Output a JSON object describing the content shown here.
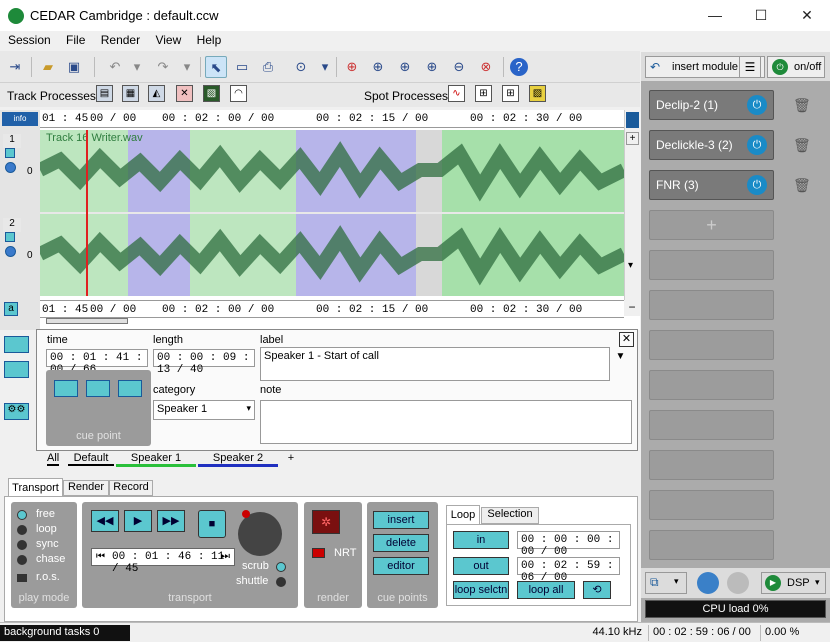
{
  "window": {
    "title": "CEDAR Cambridge : default.ccw",
    "minimize": "—",
    "maximize": "☐",
    "close": "✕"
  },
  "menu": [
    "Session",
    "File",
    "Render",
    "View",
    "Help"
  ],
  "processes": {
    "track_label": "Track Processes",
    "spot_label": "Spot Processes"
  },
  "waveform": {
    "ruler_marks": [
      "01 : 45",
      "00 / 00",
      "00 : 02 : 00 / 00",
      "00 : 02 : 15 / 00",
      "00 : 02 : 30 / 00"
    ],
    "track_name": "Track 16 Writer.wav",
    "channel_1": "1",
    "channel_2": "2",
    "zero_1": "0",
    "zero_2": "0",
    "info_label": "info",
    "a_label": "a",
    "zoom_plus": "+",
    "zoom_minus": "−"
  },
  "right_panel": {
    "insert_module": "insert module",
    "onoff": "on/off",
    "modules": [
      "Declip-2 (1)",
      "Declickle-3 (2)",
      "FNR (3)"
    ],
    "add": "+",
    "dsp": "DSP",
    "cpu_load": "CPU load 0%"
  },
  "cue": {
    "time_label": "time",
    "time_value": "00 : 01 : 41 : 00 / 66",
    "length_label": "length",
    "length_value": "00 : 00 : 09 : 13 / 40",
    "label_label": "label",
    "label_value": "Speaker 1 - Start of call",
    "category_label": "category",
    "category_value": "Speaker 1",
    "note_label": "note",
    "note_value": "",
    "cue_point_caption": "cue point",
    "close": "✕"
  },
  "cue_tabs": [
    "All",
    "Default",
    "Speaker 1",
    "Speaker 2",
    "+"
  ],
  "transport_tabs": [
    "Transport",
    "Render",
    "Record"
  ],
  "play_mode": {
    "options": [
      "free",
      "loop",
      "sync",
      "chase"
    ],
    "ros": "r.o.s.",
    "caption": "play mode"
  },
  "transport": {
    "position": "00 : 01 : 46 : 11 / 45",
    "scrub": "scrub",
    "shuttle": "shuttle",
    "caption": "transport"
  },
  "render": {
    "nrt": "NRT",
    "caption": "render"
  },
  "cue_points": {
    "insert": "insert",
    "delete": "delete",
    "editor": "editor",
    "caption": "cue points"
  },
  "loop": {
    "tabs": [
      "Loop",
      "Selection"
    ],
    "in": "in",
    "in_value": "00 : 00 : 00 : 00 / 00",
    "out": "out",
    "out_value": "00 : 02 : 59 : 06 / 00",
    "loop_selctn": "loop selctn",
    "loop_all": "loop all"
  },
  "status": {
    "background_tasks": "background tasks 0",
    "sample_rate": "44.10 kHz",
    "duration": "00 : 02 : 59 : 06 / 00",
    "percent": "0.00 %"
  },
  "colors": {
    "accent_teal": "#5bc7cf",
    "power_blue": "#1a8bc7",
    "wave_green": "#2f7d3f",
    "selection_blue": "#b4b4e8",
    "playhead": "#e02020"
  }
}
